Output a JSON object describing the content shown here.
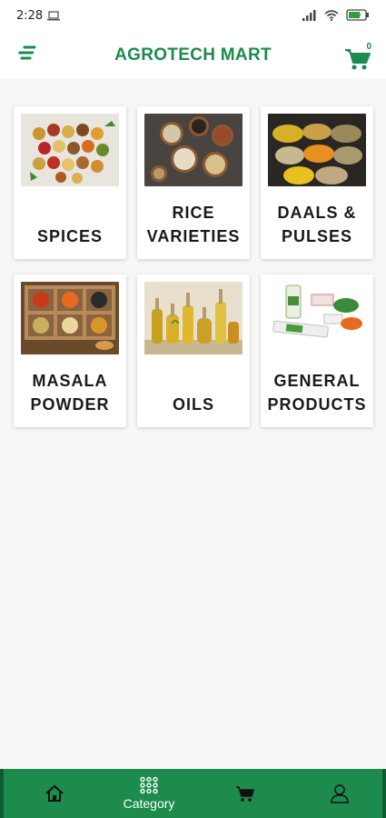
{
  "status": {
    "time": "2:28"
  },
  "appbar": {
    "title": "AGROTECH MART",
    "cart_count": "0"
  },
  "categories": [
    {
      "label": "SPICES"
    },
    {
      "label": "RICE VARIETIES"
    },
    {
      "label": "DAALS & PULSES"
    },
    {
      "label": "MASALA POWDER"
    },
    {
      "label": "OILS"
    },
    {
      "label": "GENERAL PRODUCTS"
    }
  ],
  "bottom_nav": {
    "category_label": "Category"
  },
  "colors": {
    "brand": "#1c8b4c",
    "nav_bg": "#1c8b4c",
    "bg": "#f7f7f7"
  },
  "icons": [
    "menu-icon",
    "cart-icon",
    "home-icon",
    "grid-icon",
    "user-icon"
  ]
}
